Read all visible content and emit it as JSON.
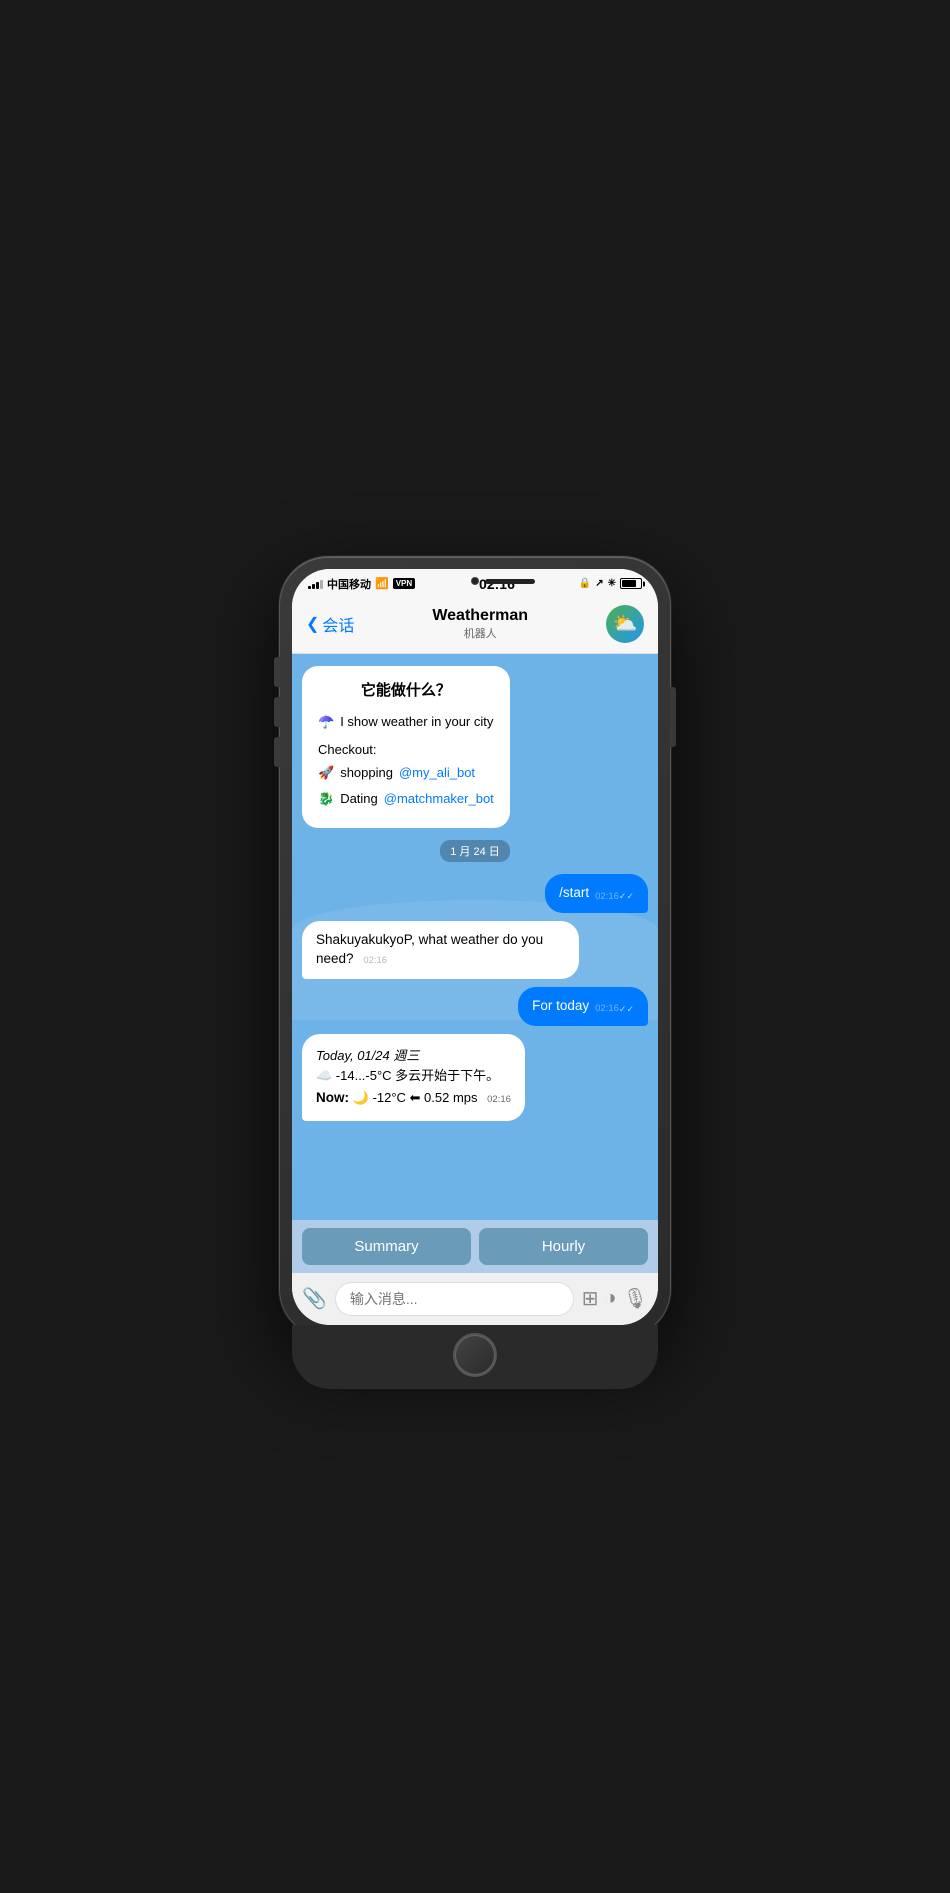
{
  "phone": {
    "status_bar": {
      "carrier": "中国移动",
      "wifi": "WiFi",
      "vpn": "VPN",
      "time": "02:16",
      "battery_pct": 80
    },
    "nav": {
      "back_label": "会话",
      "title": "Weatherman",
      "subtitle": "机器人",
      "avatar_emoji": "⛅"
    },
    "chat": {
      "bot_intro": {
        "title": "它能做什么？",
        "umbrella_line": "☂️ I show weather in your city",
        "checkout_label": "Checkout:",
        "shopping_line": "🚀 shopping",
        "shopping_link": "@my_ali_bot",
        "dating_line": "🐉 Dating",
        "dating_link": "@matchmaker_bot"
      },
      "date_badge": "1 月 24 日",
      "messages": [
        {
          "type": "outgoing",
          "text": "/start",
          "time": "02:16",
          "ticks": "✓✓"
        },
        {
          "type": "incoming",
          "text": "ShakuyakukyoP, what weather do you need?",
          "time": "02:16"
        },
        {
          "type": "outgoing",
          "text": "For today",
          "time": "02:16",
          "ticks": "✓✓"
        },
        {
          "type": "incoming_weather",
          "date_line": "Today, 01/24 週三",
          "temp_range": "☁️ -14...-5°C 多云开始于下午。",
          "now_line": "Now: 🌙 -12°C ⬅ 0.52 mps",
          "time": "02:16"
        }
      ],
      "action_buttons": [
        {
          "label": "Summary"
        },
        {
          "label": "Hourly"
        }
      ],
      "input": {
        "placeholder": "输入消息...",
        "attach_icon": "📎",
        "sticker_icon": "⊞",
        "emoji_icon": "◑",
        "mic_icon": "🎙"
      }
    }
  }
}
